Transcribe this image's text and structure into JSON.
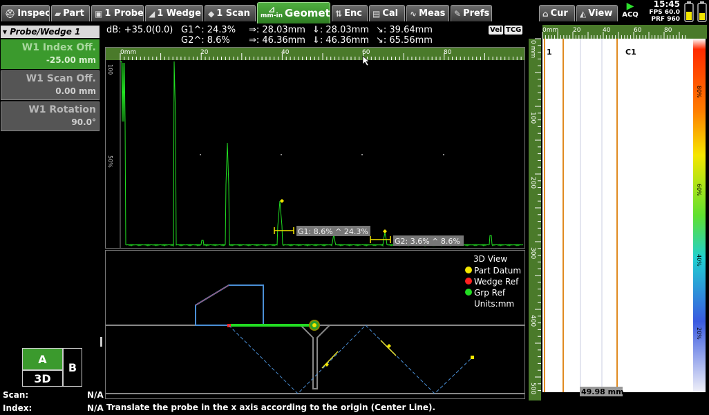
{
  "tabs": [
    {
      "label": "Inspec",
      "icon": "helmet-icon"
    },
    {
      "label": "Part",
      "icon": "part-icon"
    },
    {
      "label": "1 Probe",
      "icon": "probe-icon"
    },
    {
      "label": "1 Wedge",
      "icon": "wedge-icon"
    },
    {
      "label": "1 Scan",
      "icon": "scan-icon"
    },
    {
      "label": "Geometry",
      "icon": "mm-in-icon",
      "icon_text": "mm-in"
    },
    {
      "label": "Enc",
      "icon": "encoder-icon"
    },
    {
      "label": "Cal",
      "icon": "calibration-icon"
    },
    {
      "label": "Meas",
      "icon": "measure-icon"
    },
    {
      "label": "Prefs",
      "icon": "preferences-icon"
    },
    {
      "label": "Cur",
      "icon": "cursor-icon"
    },
    {
      "label": "View",
      "icon": "view-icon"
    }
  ],
  "acq": {
    "label": "ACQ"
  },
  "clock": {
    "time": "15:45",
    "fps": "FPS 60.0",
    "prf": "PRF 960"
  },
  "left_panel": {
    "header": "Probe/Wedge 1",
    "params": [
      {
        "label": "W1 Index Off.",
        "value": "-25.00 mm",
        "selected": true
      },
      {
        "label": "W1 Scan Off.",
        "value": "0.00 mm",
        "selected": false
      },
      {
        "label": "W1 Rotation",
        "value": "90.0°",
        "selected": false
      }
    ],
    "view_buttons": {
      "a": "A",
      "b": "B",
      "three_d": "3D"
    },
    "scan_label": "Scan:",
    "scan_value": "N/A",
    "index_label": "Index:",
    "index_value": "N/A"
  },
  "ascan_info": {
    "db": "dB: +35.0(0.0)",
    "g1": "G1^: 24.3%",
    "g2": "G2^: 8.6%",
    "r1a": "⇒: 28.03mm",
    "r1b": "⇓: 28.03mm",
    "r1c": "↘: 39.64mm",
    "r2a": "⇒: 46.36mm",
    "r2b": "⇓: 46.36mm",
    "r2c": "↘: 65.56mm",
    "vel": "Vel",
    "tcg": "TCG"
  },
  "ascan_ruler": {
    "unit": "0mm",
    "ticks": [
      "20",
      "40",
      "60",
      "80"
    ],
    "left_ticks": [
      "100",
      "50%"
    ]
  },
  "gates": {
    "g1_label": "G1: 8.6% ^ 24.3%",
    "g2_label": "G2: 3.6% ^ 8.6%"
  },
  "view3d": {
    "title": "3D View",
    "legend": [
      {
        "label": "Part Datum",
        "color": "#f2e600"
      },
      {
        "label": "Wedge Ref",
        "color": "#ff2020"
      },
      {
        "label": "Grp Ref",
        "color": "#22dd22"
      }
    ],
    "units": "Units:mm"
  },
  "bscan": {
    "top_unit": "0mm",
    "top_ticks": [
      "20",
      "40",
      "60",
      "80"
    ],
    "left_unit": "0 mm",
    "left_ticks": [
      "100",
      "200",
      "300",
      "400",
      "500"
    ],
    "label_1": "1",
    "label_c1": "C1",
    "colorbar_ticks": [
      "80%",
      "60%",
      "40%",
      "20%"
    ],
    "bottom_readout": "49.98 mm"
  },
  "status": {
    "message": "Translate the probe in the x axis according to the origin (Center Line)."
  },
  "colors": {
    "accent": "#3b9a2d",
    "signal": "#22e022",
    "ruler": "#4a7a2a",
    "gate": "#f2e600",
    "cursor": "#e08a20"
  }
}
